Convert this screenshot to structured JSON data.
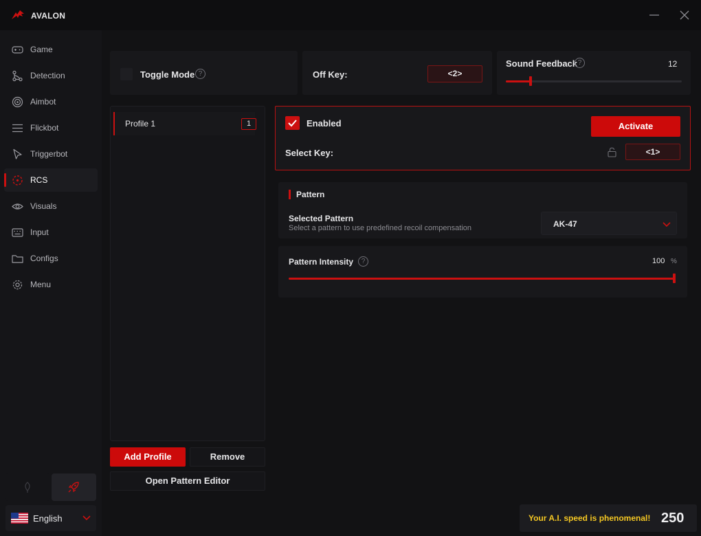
{
  "app": {
    "title": "AVALON"
  },
  "colors": {
    "accent": "#cc1010",
    "background": "#121214",
    "panel": "#18181b",
    "toast_text": "#f3c623"
  },
  "sidebar": {
    "items": [
      {
        "label": "Game",
        "icon": "gamepad-icon",
        "active": false
      },
      {
        "label": "Detection",
        "icon": "nodes-icon",
        "active": false
      },
      {
        "label": "Aimbot",
        "icon": "target-icon",
        "active": false
      },
      {
        "label": "Flickbot",
        "icon": "lines-icon",
        "active": false
      },
      {
        "label": "Triggerbot",
        "icon": "cursor-icon",
        "active": false
      },
      {
        "label": "RCS",
        "icon": "rcs-icon",
        "active": true
      },
      {
        "label": "Visuals",
        "icon": "eye-icon",
        "active": false
      },
      {
        "label": "Input",
        "icon": "keyboard-icon",
        "active": false
      },
      {
        "label": "Configs",
        "icon": "folder-icon",
        "active": false
      },
      {
        "label": "Menu",
        "icon": "gear-icon",
        "active": false
      }
    ],
    "mode_buttons": [
      {
        "icon": "leaf-icon",
        "active": false
      },
      {
        "icon": "rocket-icon",
        "active": true
      }
    ],
    "language": {
      "label": "English",
      "flag": "us-flag-icon"
    }
  },
  "top": {
    "toggle_mode": {
      "label": "Toggle Mode",
      "checked": false
    },
    "off_key": {
      "label": "Off Key:",
      "value": "<2>"
    },
    "sound_feedback": {
      "label": "Sound Feedback",
      "value": "12",
      "fraction": 0.14
    }
  },
  "profiles": {
    "items": [
      {
        "name": "Profile 1",
        "index": "1"
      }
    ],
    "add_label": "Add Profile",
    "remove_label": "Remove",
    "editor_label": "Open Pattern Editor"
  },
  "rcs": {
    "enabled": {
      "label": "Enabled",
      "checked": true
    },
    "activate_label": "Activate",
    "select_key": {
      "label": "Select Key:",
      "value": "<1>"
    }
  },
  "pattern": {
    "section_title": "Pattern",
    "selected_title": "Selected Pattern",
    "selected_desc": "Select a pattern to use predefined recoil compensation",
    "selected_value": "AK-47",
    "intensity": {
      "label": "Pattern Intensity",
      "value": "100",
      "unit": "%",
      "fraction": 1.0
    }
  },
  "toast": {
    "message": "Your A.I. speed is phenomenal!",
    "value": "250"
  }
}
